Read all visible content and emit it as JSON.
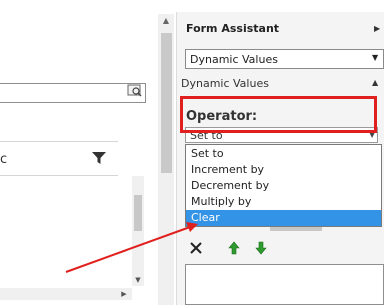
{
  "form_assistant": {
    "title": "Form Assistant",
    "dropdown_value": "Dynamic Values",
    "section_label": "Dynamic Values",
    "operator_label": "Operator:",
    "operator_selected": "Set to",
    "operator_options": [
      "Set to",
      "Increment by",
      "Decrement by",
      "Multiply by",
      "Clear"
    ],
    "highlighted_option": "Clear"
  },
  "grid": {
    "header_partial_text": "c"
  },
  "icons": {
    "lookup": "lookup-icon",
    "filter": "filter-icon",
    "delete": "delete-icon",
    "move_up": "arrow-up-icon",
    "move_down": "arrow-down-icon"
  },
  "colors": {
    "highlight": "#3393e6",
    "annotation_red": "#e0201e",
    "arrow_green": "#2e9b2e"
  }
}
